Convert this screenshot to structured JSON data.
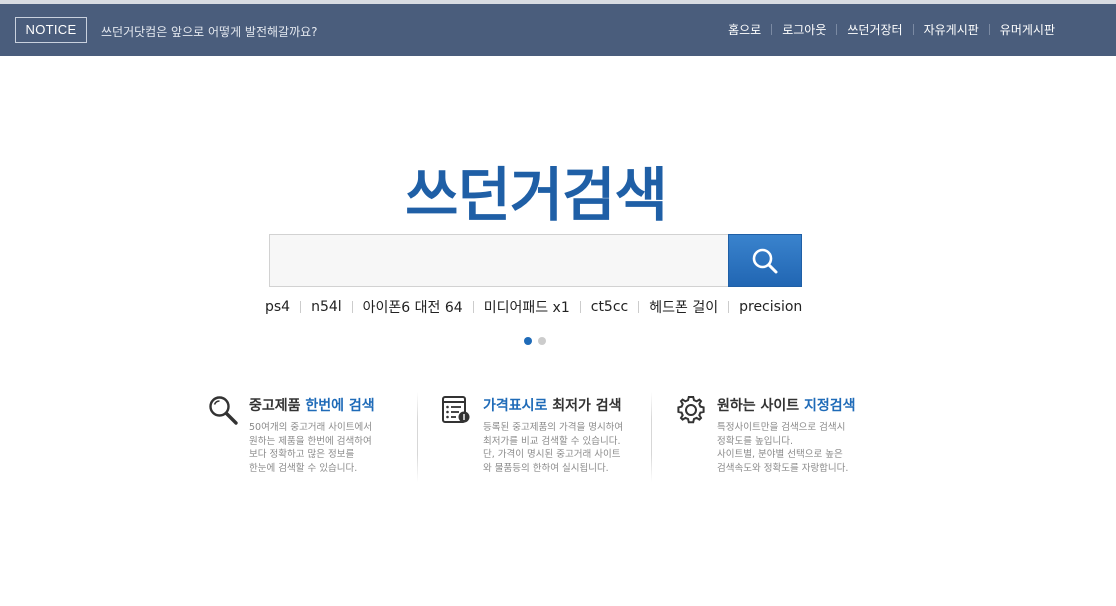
{
  "header": {
    "notice_label": "NOTICE",
    "notice_text": "쓰던거닷컴은 앞으로 어떻게 발전해갈까요?",
    "nav": [
      {
        "label": "홈으로"
      },
      {
        "label": "로그아웃"
      },
      {
        "label": "쓰던거장터"
      },
      {
        "label": "자유게시판"
      },
      {
        "label": "유머게시판"
      }
    ]
  },
  "logo": {
    "text": "쓰던거검색"
  },
  "search": {
    "value": "",
    "placeholder": "",
    "button_icon": "search-icon"
  },
  "keywords": [
    "ps4",
    "n54l",
    "아이폰6 대전 64",
    "미디어패드 x1",
    "ct5cc",
    "헤드폰 걸이",
    "precision"
  ],
  "carousel": {
    "total": 2,
    "active": 1,
    "active_color": "#1f6bb8",
    "inactive_color": "#cccccc"
  },
  "features": [
    {
      "icon": "magnifier-icon",
      "title_pre": "중고제품 ",
      "title_highlight": "한번에 검색",
      "title_post": "",
      "desc": "50여개의 중고거래 사이트에서\n원하는 제품을 한번에 검색하여\n보다 정확하고 많은 정보를\n한눈에 검색할 수 있습니다."
    },
    {
      "icon": "price-list-icon",
      "title_pre": "",
      "title_highlight": "가격표시로",
      "title_post": " 최저가 검색",
      "desc": "등록된 중고제품의 가격을 명시하여\n최저가를 비교 검색할 수 있습니다.\n단, 가격이 명시된 중고거래 사이트\n와 물품등의 한하여 실시됩니다."
    },
    {
      "icon": "gear-icon",
      "title_pre": "원하는 사이트 ",
      "title_highlight": "지정검색",
      "title_post": "",
      "desc": "특정사이트만을 검색으로 검색시\n정확도를 높입니다.\n사이트별, 분야별 선택으로 높은\n검색속도와 정확도를 자랑합니다."
    }
  ],
  "colors": {
    "header_bg": "#4a5d7c",
    "brand": "#1f5fa6",
    "highlight": "#1f6bb8"
  }
}
